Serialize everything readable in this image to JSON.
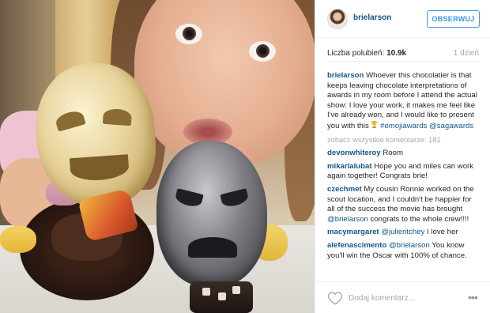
{
  "post": {
    "username": "brielarson",
    "follow_label": "OBSERWUJ",
    "likes_label": "Liczba polubień:",
    "likes_count": "10.9k",
    "time_ago": "1 dzień"
  },
  "caption": {
    "username": "brielarson",
    "text_1": "Whoever this chocolatier is that keeps leaving chocolate interpretations of awards in my room before I attend the actual show: I love your work, it makes me feel like I've already won, and I would like to present you with this",
    "hashtag": "#emojiawards",
    "mention": "@sagawards"
  },
  "view_all_label": "zobacz wszystkie komentarze: 181",
  "comments": [
    {
      "user": "devonwhiteroy",
      "text": "Room"
    },
    {
      "user": "mikarlalubat",
      "text": "Hope you and miles can work again together! Congrats brie!"
    },
    {
      "user": "czechmet",
      "text": "My cousin Ronnie worked on the scout location, and I couldn't be happier for all of the success the movie has brought",
      "mention": "@brielarson",
      "text_after": "congrats to the whole crew!!!!"
    },
    {
      "user": "macymargaret",
      "mention": "@julieritchey",
      "text": "I love her"
    },
    {
      "user": "alefenascimento",
      "mention": "@brielarson",
      "text": "You know you'll win the Oscar with 100% of chance."
    }
  ],
  "footer": {
    "comment_placeholder": "Dodaj komentarz...",
    "more_label": "•••"
  },
  "icons": {
    "heart": "heart-outline-icon",
    "trophy": "trophy-icon",
    "more": "more-options-icon"
  },
  "colors": {
    "link": "#125688",
    "follow_blue": "#3897f0",
    "muted": "#a5a7aa"
  }
}
